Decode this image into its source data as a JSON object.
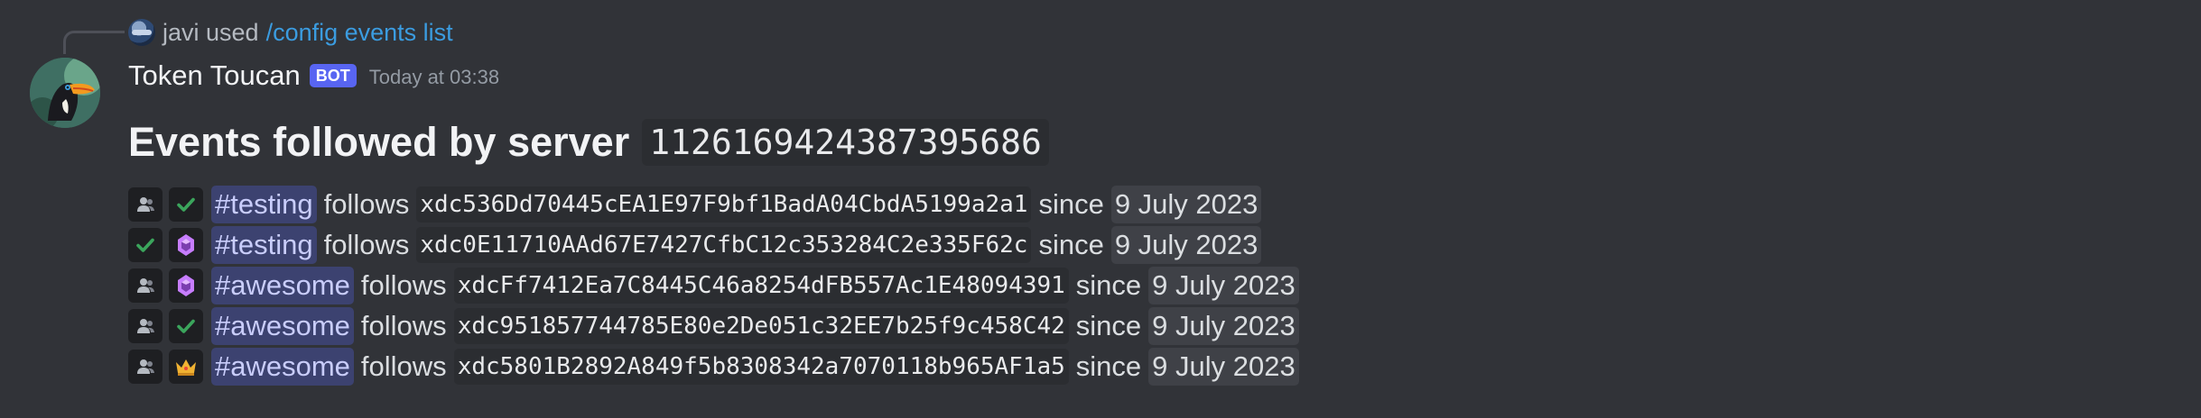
{
  "reply": {
    "user": "javi used",
    "command": "/config events list"
  },
  "message": {
    "author": "Token Toucan",
    "badge": "BOT",
    "timestamp": "Today at 03:38",
    "title": "Events followed by server",
    "server_id": "1126169424387395686"
  },
  "words": {
    "follows": "follows",
    "since": "since"
  },
  "rows": [
    {
      "icons": [
        "person-icon",
        "check-icon"
      ],
      "channel": "#testing",
      "address": "xdc536Dd70445cEA1E97F9bf1BadA04CbdA5199a2a1",
      "date": "9 July 2023"
    },
    {
      "icons": [
        "check-icon",
        "gem-icon"
      ],
      "channel": "#testing",
      "address": "xdc0E11710AAd67E7427CfbC12c353284C2e335F62c",
      "date": "9 July 2023"
    },
    {
      "icons": [
        "person-icon",
        "gem-icon"
      ],
      "channel": "#awesome",
      "address": "xdcFf7412Ea7C8445C46a8254dFB557Ac1E48094391",
      "date": "9 July 2023"
    },
    {
      "icons": [
        "person-icon",
        "check-icon"
      ],
      "channel": "#awesome",
      "address": "xdc951857744785E80e2De051c32EE7b25f9c458C42",
      "date": "9 July 2023"
    },
    {
      "icons": [
        "person-icon",
        "crown-icon"
      ],
      "channel": "#awesome",
      "address": "xdc5801B2892A849f5b8308342a7070118b965AF1a5",
      "date": "9 July 2023"
    }
  ],
  "colors": {
    "background": "#313338",
    "link": "#3b9ce0",
    "bot_badge": "#5865f2",
    "channel_mention_bg": "#3c4270",
    "check": "#3ba55c",
    "gem": "#c77dff",
    "crown": "#f0b232"
  }
}
